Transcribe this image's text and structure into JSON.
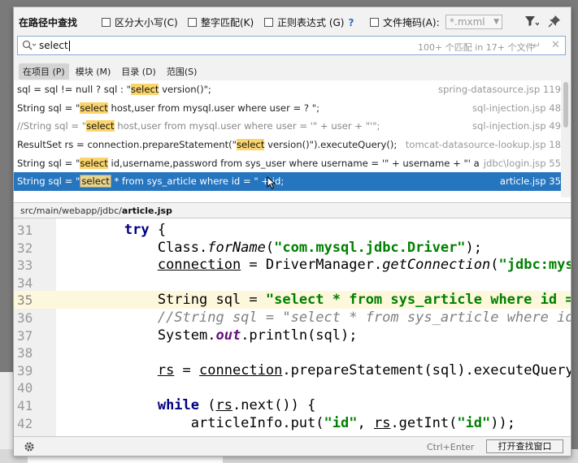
{
  "dialog": {
    "title": "在路径中查找",
    "options": {
      "match_case": "区分大小写(C)",
      "whole_words": "整字匹配(K)",
      "regex": "正则表达式 (G)",
      "regex_help": "?",
      "file_mask_label": "文件掩码(A):",
      "file_mask_value": "*.mxml"
    },
    "search": {
      "query": "select",
      "match_info": "100+ 个匹配 in 17+ 个文件"
    },
    "scope_tabs": [
      "在项目 (P)",
      "模块 (M)",
      "目录 (D)",
      "范围(S)"
    ],
    "results": [
      {
        "pre": "sql = sql != null ? sql : \"",
        "hit": "select",
        "post": " version()\";",
        "file": "spring-datasource.jsp 119"
      },
      {
        "pre": "String sql = \"",
        "hit": "select",
        "post": " host,user from mysql.user where user = ? \";",
        "file": "sql-injection.jsp 48"
      },
      {
        "pre": "//String sql = \"",
        "hit": "select",
        "post": " host,user from mysql.user where user = '\" + user + \"'\";",
        "file": "sql-injection.jsp 49"
      },
      {
        "pre": "ResultSet rs = connection.prepareStatement(\"",
        "hit": "select",
        "post": " version()\").executeQuery();",
        "file": "tomcat-datasource-lookup.jsp 18"
      },
      {
        "pre": "String sql = \"",
        "hit": "select",
        "post": " id,username,password from sys_user where username = '\" + username + \"' and password = '\" + password + \"'\";",
        "file": "jdbc\\login.jsp 55"
      },
      {
        "pre": "String sql = \"",
        "hit": "select",
        "post": " * from sys_article where id = \" + id;",
        "file": "article.jsp 35"
      }
    ],
    "preview": {
      "path_prefix": "src/main/webapp/jdbc/",
      "path_file": "article.jsp",
      "lines": [
        {
          "n": "31",
          "tokens": [
            {
              "t": "        ",
              "c": ""
            },
            {
              "t": "try",
              "c": "kw"
            },
            {
              "t": " {",
              "c": ""
            }
          ]
        },
        {
          "n": "32",
          "tokens": [
            {
              "t": "            Class.",
              "c": ""
            },
            {
              "t": "forName",
              "c": "it"
            },
            {
              "t": "(",
              "c": ""
            },
            {
              "t": "\"com.mysql.jdbc.Driver\"",
              "c": "str"
            },
            {
              "t": ");",
              "c": ""
            }
          ]
        },
        {
          "n": "33",
          "tokens": [
            {
              "t": "            ",
              "c": ""
            },
            {
              "t": "connection",
              "c": "ul"
            },
            {
              "t": " = DriverManager.",
              "c": ""
            },
            {
              "t": "getConnection",
              "c": "it"
            },
            {
              "t": "(",
              "c": ""
            },
            {
              "t": "\"jdbc:mysql://localhost",
              "c": "str"
            }
          ]
        },
        {
          "n": "34",
          "tokens": []
        },
        {
          "n": "35",
          "current": true,
          "tokens": [
            {
              "t": "            String sql = ",
              "c": ""
            },
            {
              "t": "\"select * from sys_article where id = \"",
              "c": "str"
            }
          ]
        },
        {
          "n": "36",
          "tokens": [
            {
              "t": "            ",
              "c": ""
            },
            {
              "t": "//String sql = \"select * from sys_article where id = ?\";",
              "c": "cm"
            }
          ]
        },
        {
          "n": "37",
          "tokens": [
            {
              "t": "            System.",
              "c": ""
            },
            {
              "t": "out",
              "c": "fld"
            },
            {
              "t": ".println(sql);",
              "c": ""
            }
          ]
        },
        {
          "n": "38",
          "tokens": []
        },
        {
          "n": "39",
          "tokens": [
            {
              "t": "            ",
              "c": ""
            },
            {
              "t": "rs",
              "c": "ul"
            },
            {
              "t": " = ",
              "c": ""
            },
            {
              "t": "connection",
              "c": "ul"
            },
            {
              "t": ".prepareStatement(sql).executeQuery();",
              "c": ""
            }
          ]
        },
        {
          "n": "40",
          "tokens": []
        },
        {
          "n": "41",
          "tokens": [
            {
              "t": "            ",
              "c": ""
            },
            {
              "t": "while",
              "c": "kw"
            },
            {
              "t": " (",
              "c": ""
            },
            {
              "t": "rs",
              "c": "ul"
            },
            {
              "t": ".next()) {",
              "c": ""
            }
          ]
        },
        {
          "n": "42",
          "tokens": [
            {
              "t": "                articleInfo.put(",
              "c": ""
            },
            {
              "t": "\"id\"",
              "c": "str"
            },
            {
              "t": ", ",
              "c": ""
            },
            {
              "t": "rs",
              "c": "ul"
            },
            {
              "t": ".getInt(",
              "c": ""
            },
            {
              "t": "\"id\"",
              "c": "str"
            },
            {
              "t": "));",
              "c": ""
            }
          ]
        }
      ]
    },
    "footer": {
      "shortcut": "Ctrl+Enter",
      "open_button": "打开查找窗口"
    }
  },
  "colors": {
    "selection": "#2675bf",
    "match_highlight": "#fbd56c",
    "keyword": "#000080",
    "string": "#008000",
    "current_line": "#fdf8dc"
  }
}
